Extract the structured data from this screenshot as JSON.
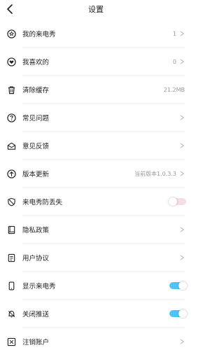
{
  "header": {
    "title": "设置",
    "back_icon": "chevron-left-icon"
  },
  "items": [
    {
      "name": "my-favorites",
      "label": "我的来电秀",
      "value": "1",
      "icon": "star-circle-icon",
      "type": "chevron"
    },
    {
      "name": "my-likes",
      "label": "我喜欢的",
      "value": "0",
      "icon": "heart-circle-icon",
      "type": "chevron"
    },
    {
      "name": "clear-cache",
      "label": "清除缓存",
      "value": "21.2MB",
      "icon": "trash-icon",
      "type": "value"
    },
    {
      "name": "faq",
      "label": "常见问题",
      "value": "",
      "icon": "question-circle-icon",
      "type": "chevron"
    },
    {
      "name": "feedback",
      "label": "意见反馈",
      "value": "",
      "icon": "envelope-open-icon",
      "type": "chevron"
    },
    {
      "name": "update",
      "label": "版本更新",
      "value": "当前版本1.0.3.3",
      "icon": "arrow-up-circle-icon",
      "type": "chevron"
    },
    {
      "name": "anti-lost",
      "label": "来电秀防丢失",
      "value": "",
      "icon": "shield-slash-icon",
      "type": "toggle",
      "on": false
    },
    {
      "name": "privacy",
      "label": "隐私政策",
      "value": "",
      "icon": "book-icon",
      "type": "chevron"
    },
    {
      "name": "agreement",
      "label": "用户协议",
      "value": "",
      "icon": "document-icon",
      "type": "chevron"
    },
    {
      "name": "show-caller",
      "label": "显示来电秀",
      "value": "",
      "icon": "phone-icon",
      "type": "toggle",
      "on": true
    },
    {
      "name": "push",
      "label": "关闭推送",
      "value": "",
      "icon": "bell-slash-icon",
      "type": "toggle",
      "on": true
    },
    {
      "name": "cancel-account",
      "label": "注销账户",
      "value": "",
      "icon": "account-x-icon",
      "type": "chevron"
    }
  ],
  "colors": {
    "toggle_on": "#4fc3f7",
    "toggle_off": "#f3dfe4",
    "text": "#222222",
    "muted": "#9a9a9a"
  }
}
